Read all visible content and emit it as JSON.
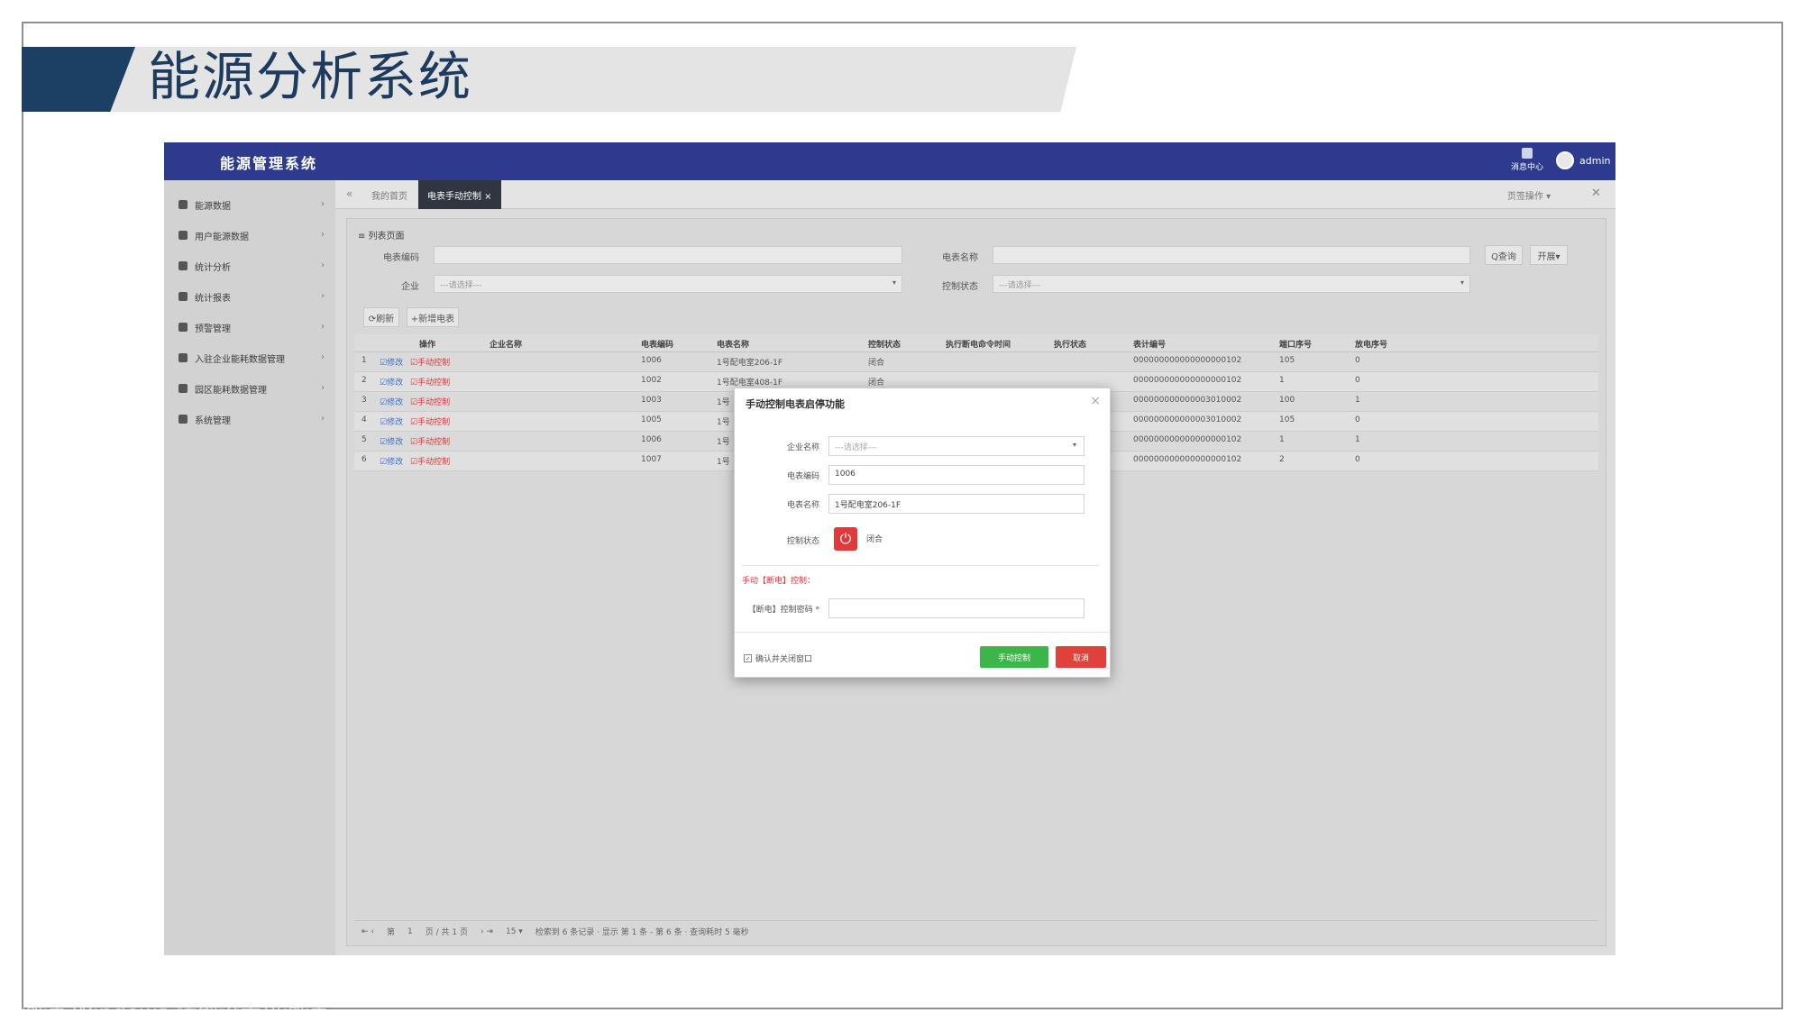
{
  "slide": {
    "title": "能源分析系统",
    "watermark": "激活 Windows 转到设置以激活"
  },
  "app": {
    "logo": "能源管理系统",
    "header": {
      "message_center": "消息中心",
      "user": "admin"
    }
  },
  "sidebar": {
    "items": [
      {
        "label": "能源数据",
        "icon": "home-icon"
      },
      {
        "label": "用户能源数据",
        "icon": "user-icon"
      },
      {
        "label": "统计分析",
        "icon": "chart-icon"
      },
      {
        "label": "统计报表",
        "icon": "table-icon"
      },
      {
        "label": "预警管理",
        "icon": "bell-icon"
      },
      {
        "label": "入驻企业能耗数据管理",
        "icon": "building-icon"
      },
      {
        "label": "园区能耗数据管理",
        "icon": "database-icon"
      },
      {
        "label": "系统管理",
        "icon": "monitor-icon"
      }
    ]
  },
  "tabs": {
    "home": "我的首页",
    "active": "电表手动控制 ×",
    "ops": "页签操作 ▾",
    "close": "✕",
    "back": "«"
  },
  "filter": {
    "panel_title": "≡ 列表页面",
    "meter_code_label": "电表编码",
    "meter_name_label": "电表名称",
    "company_label": "企业",
    "company_placeholder": "---请选择---",
    "status_label": "控制状态",
    "status_placeholder": "---请选择---",
    "search_btn": "Q查询",
    "more_btn": "开展▾",
    "refresh_btn": "⟳刷新",
    "add_btn": "+新增电表"
  },
  "grid": {
    "columns": [
      "操作",
      "企业名称",
      "电表编码",
      "电表名称",
      "控制状态",
      "执行断电命令时间",
      "执行状态",
      "表计编号",
      "端口序号",
      "放电序号"
    ],
    "rows": [
      {
        "n": "1",
        "edit": "☑修改",
        "ctl": "☑手动控制",
        "code": "1006",
        "name": "1号配电室206-1F",
        "status": "闭合",
        "serial": "000000000000000000102",
        "port": "105",
        "seq": "0"
      },
      {
        "n": "2",
        "edit": "☑修改",
        "ctl": "☑手动控制",
        "code": "1002",
        "name": "1号配电室408-1F",
        "status": "闭合",
        "serial": "000000000000000000102",
        "port": "1",
        "seq": "0"
      },
      {
        "n": "3",
        "edit": "☑修改",
        "ctl": "☑手动控制",
        "code": "1003",
        "name": "1号",
        "status": "",
        "serial": "000000000000003010002",
        "port": "100",
        "seq": "1"
      },
      {
        "n": "4",
        "edit": "☑修改",
        "ctl": "☑手动控制",
        "code": "1005",
        "name": "1号",
        "status": "",
        "serial": "000000000000003010002",
        "port": "105",
        "seq": "0"
      },
      {
        "n": "5",
        "edit": "☑修改",
        "ctl": "☑手动控制",
        "code": "1006",
        "name": "1号",
        "status": "",
        "serial": "000000000000000000102",
        "port": "1",
        "seq": "1"
      },
      {
        "n": "6",
        "edit": "☑修改",
        "ctl": "☑手动控制",
        "code": "1007",
        "name": "1号",
        "status": "",
        "serial": "000000000000000000102",
        "port": "2",
        "seq": "0"
      }
    ]
  },
  "pager": {
    "nav": "⇤  ‹",
    "page_label": "第",
    "page": "1",
    "of": "页 / 共 1 页",
    "nav2": "›  ⇥",
    "size": "15 ▾",
    "summary": "检索到 6 条记录 · 显示 第 1 条 - 第 6 条 · 查询耗时 5 毫秒"
  },
  "modal": {
    "title": "手动控制电表启停功能",
    "close": "×",
    "company_label": "企业名称",
    "company_placeholder": "---请选择---",
    "code_label": "电表编码",
    "code_value": "1006",
    "name_label": "电表名称",
    "name_value": "1号配电室206-1F",
    "state_label": "控制状态",
    "state_value": "闭合",
    "warn": "手动【断电】控制：",
    "password_label": "【断电】控制密码 *",
    "password_value": "",
    "confirm_close": "确认并关闭窗口",
    "ok_btn": "手动控制",
    "cancel_btn": "取消"
  },
  "colors": {
    "header": "#2d3b8e",
    "title_accent": "#1b4064",
    "ok": "#3cb54a",
    "danger": "#e0413b"
  }
}
